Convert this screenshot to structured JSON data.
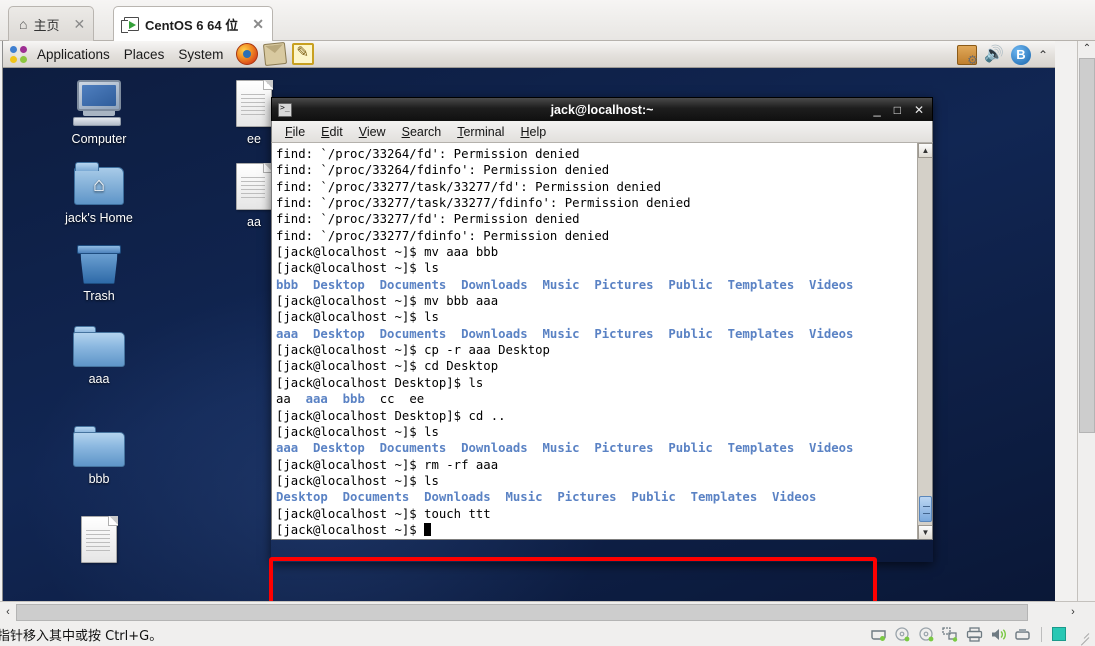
{
  "vmware": {
    "tabs": [
      {
        "label": "主页",
        "icon": "home-icon",
        "active": false,
        "close": "✕"
      },
      {
        "label": "CentOS 6 64 位",
        "icon": "virtual-machine-icon",
        "active": true,
        "close": "✕"
      }
    ],
    "status_text": "指针移入其中或按 Ctrl+G。",
    "devices": [
      "hard-disk-icon",
      "cd-drive-icon",
      "cd-drive-2-icon",
      "network-adapter-icon",
      "printer-icon",
      "sound-card-icon",
      "usb-device-icon"
    ],
    "scroll_left_arrow": "‹",
    "scroll_right_arrow": "›",
    "scroll_up_arrow": "⌃",
    "scroll_down_arrow": "⌄"
  },
  "gnome_panel": {
    "menus": [
      "Applications",
      "Places",
      "System"
    ],
    "launchers": [
      "firefox-icon",
      "evolution-mail-icon",
      "gedit-text-editor-icon"
    ],
    "tray": [
      "package-updater-icon",
      "volume-icon",
      "bluetooth-icon",
      "panel-collapse-arrow"
    ],
    "volume_glyph": "🔊",
    "bluetooth_glyph": "B",
    "caret_glyph": "⌃"
  },
  "desktop": {
    "icons": [
      {
        "label": "Computer",
        "type": "computer"
      },
      {
        "label": "jack's Home",
        "type": "home-folder"
      },
      {
        "label": "Trash",
        "type": "trash"
      },
      {
        "label": "aaa",
        "type": "folder"
      },
      {
        "label": "bbb",
        "type": "folder"
      },
      {
        "label": "",
        "type": "document"
      },
      {
        "label": "ee",
        "type": "document"
      },
      {
        "label": "aa",
        "type": "document"
      }
    ]
  },
  "terminal": {
    "title": "jack@localhost:~",
    "menus": [
      {
        "label": "File",
        "accel": "F"
      },
      {
        "label": "Edit",
        "accel": "E"
      },
      {
        "label": "View",
        "accel": "V"
      },
      {
        "label": "Search",
        "accel": "S"
      },
      {
        "label": "Terminal",
        "accel": "T"
      },
      {
        "label": "Help",
        "accel": "H"
      }
    ],
    "window_buttons": [
      "minimize",
      "maximize",
      "close"
    ],
    "lines": [
      {
        "text": "find: `/proc/33264/fd': Permission denied",
        "kind": "plain"
      },
      {
        "text": "find: `/proc/33264/fdinfo': Permission denied",
        "kind": "plain"
      },
      {
        "text": "find: `/proc/33277/task/33277/fd': Permission denied",
        "kind": "plain"
      },
      {
        "text": "find: `/proc/33277/task/33277/fdinfo': Permission denied",
        "kind": "plain"
      },
      {
        "text": "find: `/proc/33277/fd': Permission denied",
        "kind": "plain"
      },
      {
        "text": "find: `/proc/33277/fdinfo': Permission denied",
        "kind": "plain"
      },
      {
        "text": "[jack@localhost ~]$ mv aaa bbb",
        "kind": "plain"
      },
      {
        "text": "[jack@localhost ~]$ ls",
        "kind": "plain"
      },
      {
        "text": "bbb  Desktop  Documents  Downloads  Music  Pictures  Public  Templates  Videos",
        "kind": "dirlist"
      },
      {
        "text": "[jack@localhost ~]$ mv bbb aaa",
        "kind": "plain"
      },
      {
        "text": "[jack@localhost ~]$ ls",
        "kind": "plain"
      },
      {
        "text": "aaa  Desktop  Documents  Downloads  Music  Pictures  Public  Templates  Videos",
        "kind": "dirlist"
      },
      {
        "text": "[jack@localhost ~]$ cp -r aaa Desktop",
        "kind": "plain"
      },
      {
        "text": "[jack@localhost ~]$ cd Desktop",
        "kind": "plain"
      },
      {
        "text": "[jack@localhost Desktop]$ ls",
        "kind": "plain"
      },
      {
        "text": "aa  aaa  bbb  cc  ee",
        "kind": "mixed"
      },
      {
        "text": "[jack@localhost Desktop]$ cd ..",
        "kind": "plain"
      },
      {
        "text": "[jack@localhost ~]$ ls",
        "kind": "plain"
      },
      {
        "text": "aaa  Desktop  Documents  Downloads  Music  Pictures  Public  Templates  Videos",
        "kind": "dirlist"
      },
      {
        "text": "[jack@localhost ~]$ rm -rf aaa",
        "kind": "plain"
      },
      {
        "text": "[jack@localhost ~]$ ls",
        "kind": "plain"
      },
      {
        "text": "Desktop  Documents  Downloads  Music  Pictures  Public  Templates  Videos",
        "kind": "dirlist"
      },
      {
        "text": "[jack@localhost ~]$ touch ttt",
        "kind": "plain"
      },
      {
        "text": "[jack@localhost ~]$ ",
        "kind": "prompt-cursor"
      }
    ],
    "mixed_line_dirs": [
      "aaa",
      "bbb"
    ],
    "dir_color": "#5a82c4",
    "text_color": "#000000",
    "background": "#ffffff"
  },
  "annotation": {
    "highlight_color": "#ff0000",
    "highlighted_commands": [
      "[jack@localhost ~]$ touch ttt",
      "[jack@localhost ~]$ "
    ]
  }
}
